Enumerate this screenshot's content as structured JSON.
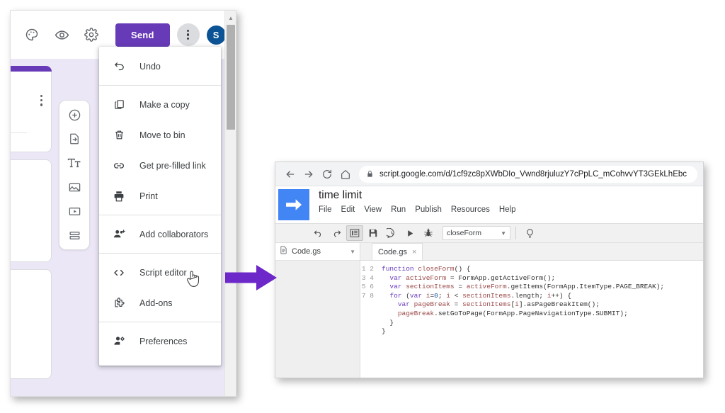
{
  "forms": {
    "header": {
      "icons": [
        {
          "name": "palette-icon",
          "title": "Customise theme"
        },
        {
          "name": "eye-icon",
          "title": "Preview"
        },
        {
          "name": "gear-icon",
          "title": "Settings"
        }
      ],
      "send_label": "Send",
      "more_label": "More",
      "avatar_initial": "S"
    },
    "float_toolbar": [
      {
        "name": "add-question-icon",
        "title": "Add question"
      },
      {
        "name": "import-questions-icon",
        "title": "Import questions"
      },
      {
        "name": "add-title-icon",
        "title": "Add title and description"
      },
      {
        "name": "add-image-icon",
        "title": "Add image"
      },
      {
        "name": "add-video-icon",
        "title": "Add video"
      },
      {
        "name": "add-section-icon",
        "title": "Add section"
      }
    ],
    "menu": {
      "groups": [
        {
          "items": [
            {
              "label": "Undo",
              "icon": "undo-icon"
            }
          ]
        },
        {
          "items": [
            {
              "label": "Make a copy",
              "icon": "copy-icon"
            },
            {
              "label": "Move to bin",
              "icon": "trash-icon"
            },
            {
              "label": "Get pre-filled link",
              "icon": "link-icon"
            },
            {
              "label": "Print",
              "icon": "print-icon"
            }
          ]
        },
        {
          "items": [
            {
              "label": "Add collaborators",
              "icon": "add-person-icon"
            }
          ]
        },
        {
          "items": [
            {
              "label": "Script editor",
              "icon": "code-brackets-icon"
            },
            {
              "label": "Add-ons",
              "icon": "puzzle-piece-icon"
            }
          ]
        },
        {
          "items": [
            {
              "label": "Preferences",
              "icon": "person-gear-icon"
            }
          ]
        }
      ]
    }
  },
  "arrow": {
    "name": "purple-right-arrow",
    "color": "#6d28c9"
  },
  "script_editor": {
    "browser": {
      "back_label": "Back",
      "forward_label": "Forward",
      "reload_label": "Reload",
      "home_label": "Home",
      "url": "script.google.com/d/1cf9zc8pXWbDIo_Vwnd8rjuluzY7cPpLC_mCohvvYT3GEkLhEbc"
    },
    "title": "time limit",
    "menubar": [
      "File",
      "Edit",
      "View",
      "Run",
      "Publish",
      "Resources",
      "Help"
    ],
    "toolbar": {
      "buttons": [
        {
          "name": "undo-icon",
          "title": "Undo"
        },
        {
          "name": "redo-icon",
          "title": "Redo"
        },
        {
          "name": "indent-icon",
          "title": "Toggle sidebar"
        },
        {
          "name": "save-icon",
          "title": "Save"
        },
        {
          "name": "comment-icon",
          "title": "Comment"
        },
        {
          "name": "run-icon",
          "title": "Run"
        },
        {
          "name": "debug-icon",
          "title": "Debug"
        }
      ],
      "function_selected": "closeForm",
      "hint_icon": "lightbulb-icon"
    },
    "sidebar": {
      "file_name": "Code.gs",
      "file_icon": "file-icon"
    },
    "tab": {
      "label": "Code.gs",
      "close_label": "×"
    },
    "code": {
      "line_numbers": [
        "1",
        "2",
        "3",
        "4",
        "5",
        "6",
        "7",
        "8"
      ],
      "lines": [
        "function closeForm() {",
        "  var activeForm = FormApp.getActiveForm();",
        "  var sectionItems = activeForm.getItems(FormApp.ItemType.PAGE_BREAK);",
        "  for (var i=0; i < sectionItems.length; i++) {",
        "    var pageBreak = sectionItems[i].asPageBreakItem();",
        "    pageBreak.setGoToPage(FormApp.PageNavigationType.SUBMIT);",
        "  }",
        "}"
      ]
    }
  },
  "colors": {
    "forms_purple": "#673ab7",
    "forms_bg": "#ece7f6",
    "arrow_purple": "#6d28c9",
    "gas_blue": "#4285f4",
    "avatar_blue": "#0b5394"
  }
}
